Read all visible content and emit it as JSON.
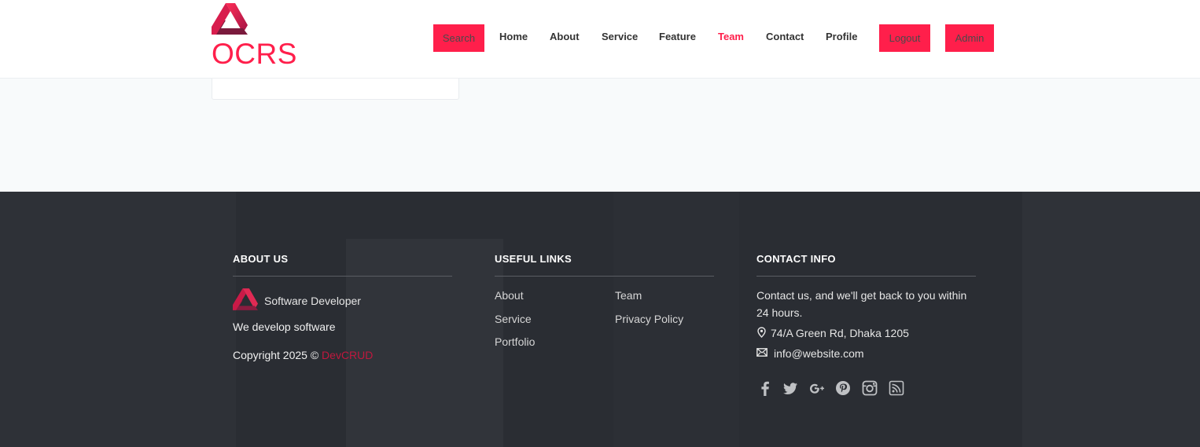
{
  "brand": {
    "name": "OCRS"
  },
  "nav": {
    "search_label": "Search",
    "home": "Home",
    "about": "About",
    "service": "Service",
    "feature": "Feature",
    "team": "Team",
    "contact": "Contact",
    "profile": "Profile",
    "logout_label": "Logout",
    "admin_label": "Admin",
    "active": "Team"
  },
  "footer": {
    "about": {
      "title": "ABOUT US",
      "company": "Software Developer",
      "tagline": "We develop software",
      "copyright_prefix": "Copyright 2025 ©",
      "copyright_brand": "DevCRUD"
    },
    "links": {
      "title": "USEFUL LINKS",
      "col1": [
        "About",
        "Service",
        "Portfolio"
      ],
      "col2": [
        "Team",
        "Privacy Policy"
      ]
    },
    "contact": {
      "title": "CONTACT INFO",
      "line1": "Contact us, and we'll get back to you within",
      "line2": "24 hours.",
      "address": "74/A Green Rd, Dhaka 1205",
      "email": "info@website.com",
      "social": [
        "facebook-icon",
        "twitter-icon",
        "google-plus-icon",
        "pinterest-icon",
        "instagram-icon",
        "rss-icon"
      ]
    }
  },
  "colors": {
    "accent": "#ff1f4b",
    "footer_bg": "#2a2d33",
    "header_bg": "#ffffff"
  }
}
